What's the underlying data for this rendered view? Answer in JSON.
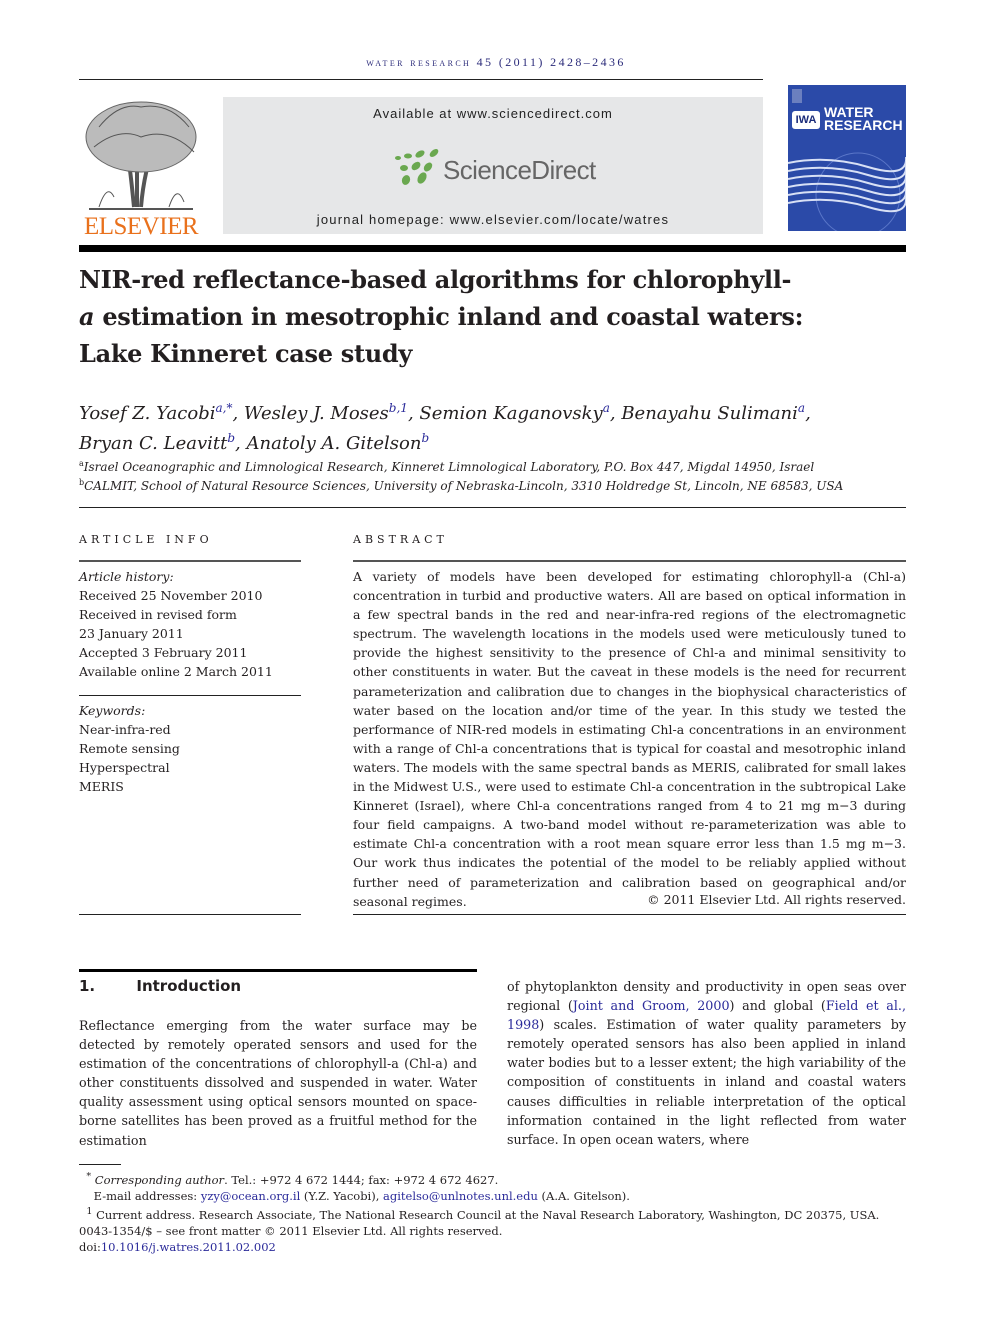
{
  "header": {
    "running_head": "water research 45 (2011) 2428–2436",
    "publisher": "ELSEVIER",
    "available_at": "Available at www.sciencedirect.com",
    "sciencedirect": "ScienceDirect",
    "journal_homepage": "journal homepage: www.elsevier.com/locate/watres",
    "cover_title_line1": "WATER",
    "cover_title_line2": "RESEARCH",
    "cover_badge": "IWA",
    "colors": {
      "running_head": "#2b2b7a",
      "elsevier": "#e9711c",
      "sd_green": "#6aa84f",
      "cover_blue": "#2b4aa8",
      "link": "#2b2b9a"
    }
  },
  "article": {
    "title_line1": "NIR-red reflectance-based algorithms for chlorophyll-",
    "title_line2_italic": "a",
    "title_line2": " estimation in mesotrophic inland and coastal waters:",
    "title_line3": "Lake Kinneret case study",
    "authors": [
      {
        "name": "Yosef Z. Yacobi",
        "sup": "a,*"
      },
      {
        "name": "Wesley J. Moses",
        "sup": "b,1"
      },
      {
        "name": "Semion Kaganovsky",
        "sup": "a"
      },
      {
        "name": "Benayahu Sulimani",
        "sup": "a"
      },
      {
        "name": "Bryan C. Leavitt",
        "sup": "b"
      },
      {
        "name": "Anatoly A. Gitelson",
        "sup": "b"
      }
    ],
    "affiliations": [
      {
        "sup": "a",
        "text": "Israel Oceanographic and Limnological Research, Kinneret Limnological Laboratory, P.O. Box 447, Migdal 14950, Israel"
      },
      {
        "sup": "b",
        "text": "CALMIT, School of Natural Resource Sciences, University of Nebraska-Lincoln, 3310 Holdredge St, Lincoln, NE 68583, USA"
      }
    ]
  },
  "article_info": {
    "heading": "ARTICLE INFO",
    "history_label": "Article history:",
    "history": [
      "Received 25 November 2010",
      "Received in revised form",
      "23 January 2011",
      "Accepted 3 February 2011",
      "Available online 2 March 2011"
    ],
    "keywords_label": "Keywords:",
    "keywords": [
      "Near-infra-red",
      "Remote sensing",
      "Hyperspectral",
      "MERIS"
    ]
  },
  "abstract": {
    "heading": "ABSTRACT",
    "text": "A variety of models have been developed for estimating chlorophyll-a (Chl-a) concentration in turbid and productive waters. All are based on optical information in a few spectral bands in the red and near-infra-red regions of the electromagnetic spectrum. The wavelength locations in the models used were meticulously tuned to provide the highest sensitivity to the presence of Chl-a and minimal sensitivity to other constituents in water. But the caveat in these models is the need for recurrent parameterization and calibration due to changes in the biophysical characteristics of water based on the location and/or time of the year. In this study we tested the performance of NIR-red models in estimating Chl-a concentrations in an environment with a range of Chl-a concentrations that is typical for coastal and mesotrophic inland waters. The models with the same spectral bands as MERIS, calibrated for small lakes in the Midwest U.S., were used to estimate Chl-a concentration in the subtropical Lake Kinneret (Israel), where Chl-a concentrations ranged from 4 to 21 mg m−3 during four field campaigns. A two-band model without re-parameterization was able to estimate Chl-a concentration with a root mean square error less than 1.5 mg m−3. Our work thus indicates the potential of the model to be reliably applied without further need of parameterization and calibration based on geographical and/or seasonal regimes.",
    "copyright": "© 2011 Elsevier Ltd. All rights reserved."
  },
  "intro": {
    "number": "1.",
    "heading": "Introduction",
    "left_text": "Reflectance emerging from the water surface may be detected by remotely operated sensors and used for the estimation of the concentrations of chlorophyll-a (Chl-a) and other constituents dissolved and suspended in water. Water quality assessment using optical sensors mounted on space-borne satellites has been proved as a fruitful method for the estimation",
    "right_pre": "of phytoplankton density and productivity in open seas over regional (",
    "ref1": "Joint and Groom, 2000",
    "right_mid": ") and global (",
    "ref2": "Field et al., 1998",
    "right_post": ") scales. Estimation of water quality parameters by remotely operated sensors has also been applied in inland water bodies but to a lesser extent; the high variability of the composition of constituents in inland and coastal waters causes difficulties in reliable interpretation of the optical information contained in the light reflected from water surface. In open ocean waters, where"
  },
  "footnotes": {
    "corr_mark": "*",
    "corr_label": "Corresponding author",
    "corr_text": ". Tel.: +972 4 672 1444; fax: +972 4 672 4627.",
    "email_label": "E-mail addresses: ",
    "email1": "yzy@ocean.org.il",
    "email1_who": " (Y.Z. Yacobi), ",
    "email2": "agitelso@unlnotes.unl.edu",
    "email2_who": " (A.A. Gitelson).",
    "note1_mark": "1",
    "note1_text": " Current address. Research Associate, The National Research Council at the Naval Research Laboratory, Washington, DC 20375, USA.",
    "front_matter": "0043-1354/$ – see front matter © 2011 Elsevier Ltd. All rights reserved.",
    "doi_label": "doi:",
    "doi": "10.1016/j.watres.2011.02.002"
  }
}
